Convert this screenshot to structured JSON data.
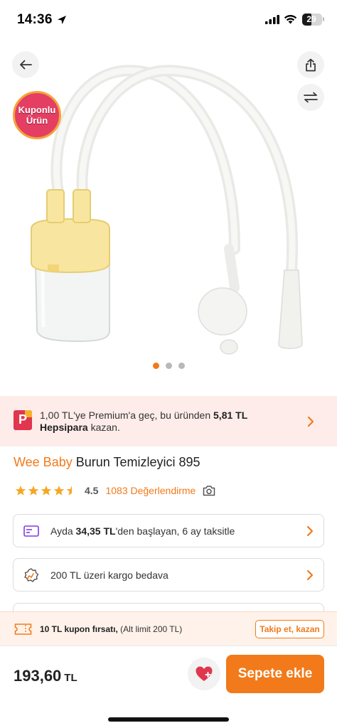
{
  "status_bar": {
    "time": "14:36",
    "battery": "29",
    "icons": [
      "location-arrow-icon",
      "cellular-signal-icon",
      "wifi-icon",
      "battery-icon"
    ]
  },
  "header": {
    "icons": [
      "back-arrow-icon",
      "share-icon",
      "compare-arrows-icon"
    ]
  },
  "badge": {
    "line1": "Kuponlu",
    "line2": "Ürün"
  },
  "gallery": {
    "image_count": 3,
    "active_index": 0
  },
  "premium": {
    "text_part1": "1,00 TL'ye Premium'a geç, bu üründen ",
    "amount": "5,81 TL",
    "brand": "Hepsipara",
    "text_part2": " kazan.",
    "logo_letter": "P"
  },
  "product": {
    "brand": "Wee Baby",
    "name": "Burun Temizleyici 895",
    "rating": "4.5",
    "rating_numeric": 4.5,
    "reviews": "1083 Değerlendirme"
  },
  "cards": {
    "installment": {
      "prefix": "Ayda ",
      "amount": "34,35 TL",
      "suffix": "'den başlayan, 6 ay taksitle"
    },
    "cargo": {
      "text": "200 TL üzeri kargo bedava"
    }
  },
  "coupon": {
    "title": "10 TL kupon fırsatı,",
    "limit": "(Alt limit 200 TL)",
    "button": "Takip et, kazan"
  },
  "footer": {
    "price": "193,60",
    "currency": "TL",
    "add_to_cart": "Sepete ekle"
  },
  "colors": {
    "accent": "#f27a1a",
    "heart": "#e0364e",
    "star": "#f6a623",
    "premium_bg": "#fdecea"
  }
}
